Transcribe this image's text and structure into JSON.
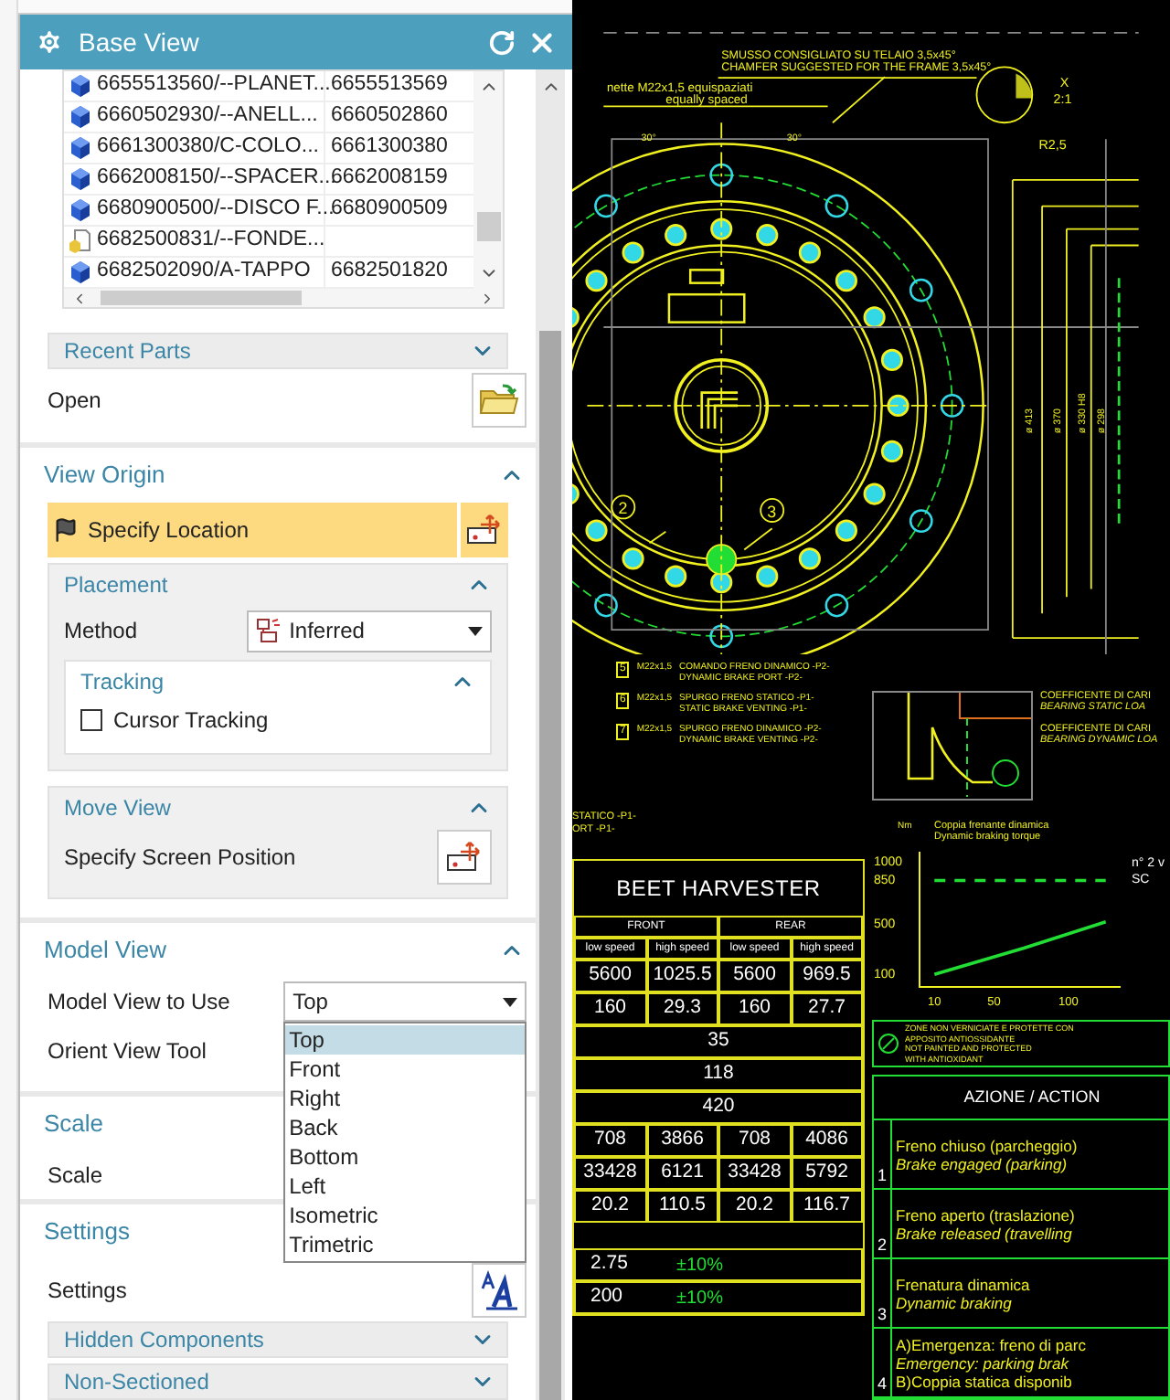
{
  "dialog": {
    "title": "Base View"
  },
  "parts_list": {
    "rows": [
      {
        "kind": "part",
        "name": "6655513560/--PLANET...",
        "number": "6655513569"
      },
      {
        "kind": "part",
        "name": "6660502930/--ANELL...",
        "number": "6660502860"
      },
      {
        "kind": "part",
        "name": "6661300380/C-COLO...",
        "number": "6661300380"
      },
      {
        "kind": "part",
        "name": "6662008150/--SPACER...",
        "number": "6662008159"
      },
      {
        "kind": "part",
        "name": "6680900500/--DISCO F...",
        "number": "6680900509"
      },
      {
        "kind": "file",
        "name": "6682500831/--FONDE..."
      },
      {
        "kind": "part",
        "name": "6682502090/A-TAPPO",
        "number": "6682501820"
      }
    ]
  },
  "recent_parts": {
    "title": "Recent Parts",
    "expanded": false,
    "open_label": "Open"
  },
  "view_origin": {
    "title": "View Origin",
    "expanded": true,
    "specify_location": "Specify Location",
    "placement": {
      "title": "Placement",
      "expanded": true,
      "method_label": "Method",
      "method_value": "Inferred",
      "tracking": {
        "title": "Tracking",
        "expanded": true,
        "cursor_tracking": {
          "label": "Cursor Tracking",
          "checked": false
        }
      }
    },
    "move_view": {
      "title": "Move View",
      "expanded": true,
      "label": "Specify Screen Position"
    }
  },
  "model_view": {
    "title": "Model View",
    "expanded": true,
    "view_label": "Model View to Use",
    "value": "Top",
    "orient_label": "Orient View Tool",
    "options": [
      {
        "label": "Top",
        "selected": true
      },
      {
        "label": "Front",
        "selected": false
      },
      {
        "label": "Right",
        "selected": false
      },
      {
        "label": "Back",
        "selected": false
      },
      {
        "label": "Bottom",
        "selected": false
      },
      {
        "label": "Left",
        "selected": false
      },
      {
        "label": "Isometric",
        "selected": false
      },
      {
        "label": "Trimetric",
        "selected": false
      }
    ]
  },
  "scale": {
    "title": "Scale",
    "label": "Scale"
  },
  "settings": {
    "title": "Settings",
    "label": "Settings",
    "subsections": [
      {
        "title": "Hidden Components",
        "expanded": false
      },
      {
        "title": "Non-Sectioned",
        "expanded": false
      }
    ]
  },
  "drawing": {
    "notes": [
      "SMUSSO CONSIGLIATO SU TELAIO 3,5x45°",
      "CHAMFER SUGGESTED FOR THE FRAME 3,5x45°",
      "nette M22x1,5 equispaziati",
      "equally spaced"
    ],
    "detail_label": "X",
    "detail_scale": "2:1",
    "radius": "R2,5",
    "angles": [
      "30°",
      "30°"
    ],
    "diameters": [
      "ø 413",
      "ø 370",
      "ø 330 H8",
      "ø 298"
    ],
    "callouts": [
      "2",
      "3"
    ],
    "coefficients": [
      "COEFFICENTE DI CARI",
      "BEARING STATIC LOA",
      "COEFFICENTE DI CARI",
      "BEARING DYNAMIC LOA"
    ],
    "ports": [
      {
        "number": "5",
        "thread": "M22x1,5",
        "it": "COMANDO FRENO DINAMICO -P2-",
        "en": "DYNAMIC BRAKE PORT -P2-"
      },
      {
        "number": "6",
        "thread": "M22x1,5",
        "it": "SPURGO FRENO STATICO -P1-",
        "en": "STATIC BRAKE VENTING -P1-"
      },
      {
        "number": "7",
        "thread": "M22x1,5",
        "it": "SPURGO FRENO DINAMICO -P2-",
        "en": "DYNAMIC BRAKE VENTING -P2-"
      }
    ],
    "fragments": [
      "STATICO -P1-",
      "ORT -P1-"
    ],
    "beet_table": {
      "title": "BEET HARVESTER",
      "groups": [
        "FRONT",
        "REAR"
      ],
      "speeds": [
        "low speed",
        "high speed",
        "low speed",
        "high speed"
      ],
      "rows": [
        [
          "5600",
          "1025.5",
          "5600",
          "969.5"
        ],
        [
          "160",
          "29.3",
          "160",
          "27.7"
        ],
        [
          "35"
        ],
        [
          "118"
        ],
        [
          "420"
        ],
        [
          "708",
          "3866",
          "708",
          "4086"
        ],
        [
          "33428",
          "6121",
          "33428",
          "5792"
        ],
        [
          "20.2",
          "110.5",
          "20.2",
          "116.7"
        ]
      ],
      "tolerance_rows": [
        {
          "value": "2.75",
          "tolerance": "±10%"
        },
        {
          "value": "200",
          "tolerance": "±10%"
        }
      ]
    },
    "chart": {
      "side_texts": [
        "n° 2 v",
        "SC"
      ],
      "subtitle": "Dynamic braking torque",
      "chart_data": {
        "type": "line",
        "title": "Coppia frenante dinamica",
        "ylabel": "Nm",
        "x": [
          10,
          70,
          125
        ],
        "series": [
          {
            "color": "#22dd33",
            "values": [
              100,
              310,
              520
            ]
          },
          {
            "color": "#22dd33",
            "line_style": "dashed",
            "values": [
              850,
              850,
              850
            ]
          }
        ],
        "xlim": [
          0,
          135
        ],
        "ylim": [
          0,
          1080
        ],
        "xticks": [
          10,
          50,
          100
        ],
        "yticks": [
          100,
          500,
          850,
          1000
        ]
      }
    },
    "coating_note": [
      "ZONE NON VERNICIATE E PROTETTE CON",
      "APPOSITO ANTIOSSIDANTE",
      "NOT PAINTED AND PROTECTED",
      "WITH ANTIOXIDANT"
    ],
    "action_table": {
      "title": "AZIONE / ACTION",
      "rows": [
        {
          "number": "1",
          "lines": [
            "Freno chiuso (parcheggio)",
            "Brake engaged (parking)"
          ]
        },
        {
          "number": "2",
          "lines": [
            "Freno aperto (traslazione)",
            "Brake released (travelling"
          ]
        },
        {
          "number": "3",
          "lines": [
            "Frenatura dinamica",
            "Dynamic braking"
          ]
        },
        {
          "number": "4",
          "lines": [
            "A)Emergenza: freno di parc",
            "Emergency: parking brak",
            "B)Coppia statica disponib"
          ]
        }
      ]
    }
  }
}
